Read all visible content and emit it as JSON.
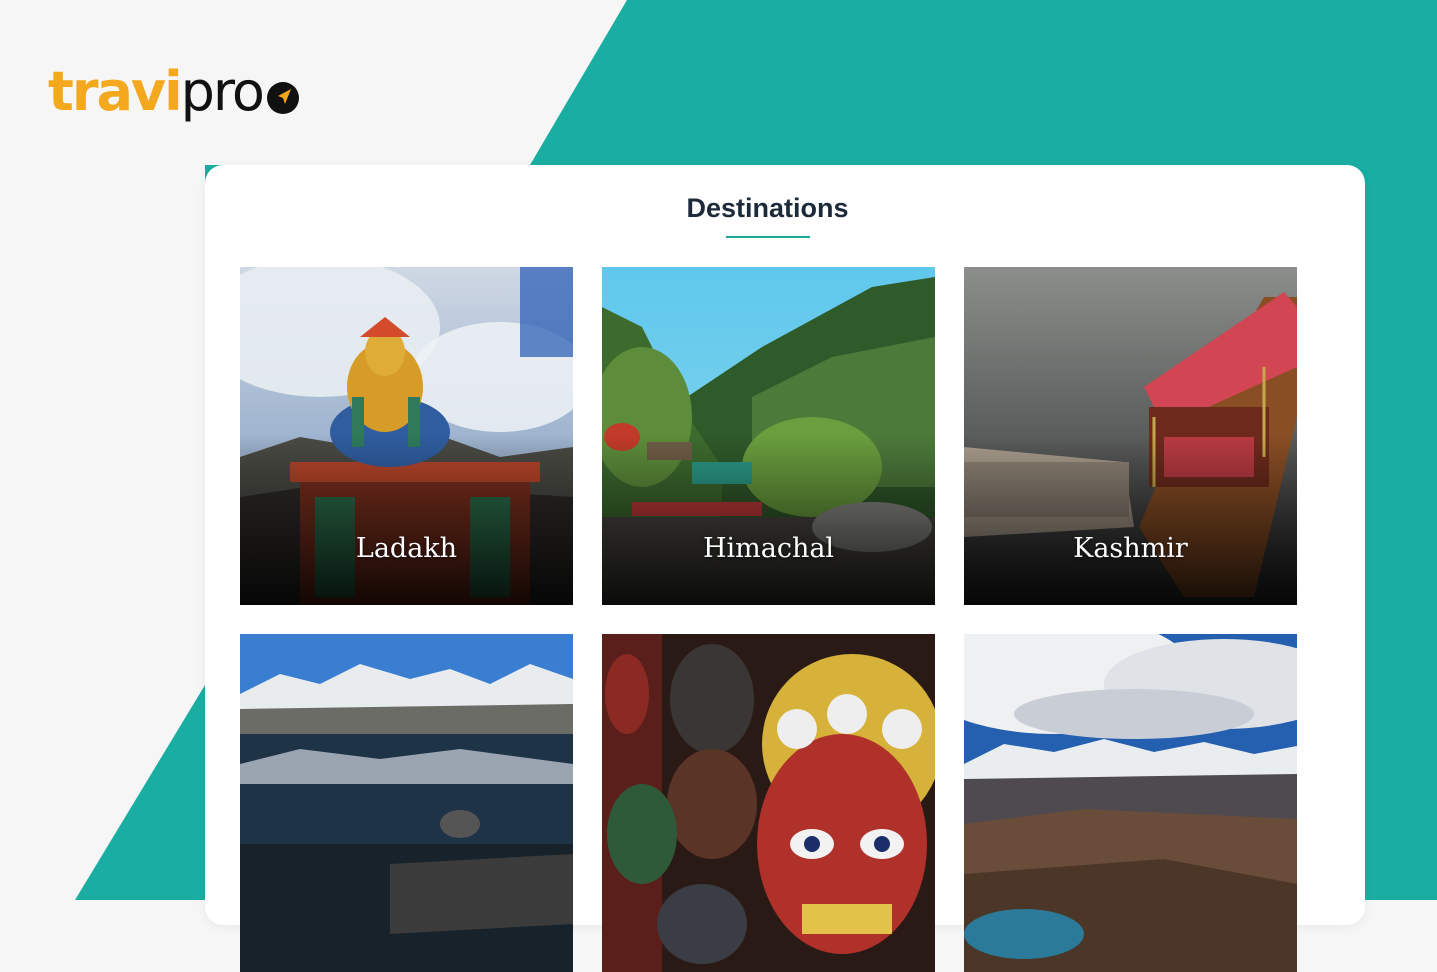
{
  "brand": {
    "name_part1": "travi",
    "name_part2": "pro",
    "accent_color": "#f4a81d",
    "icon": "navigation-arrow-icon"
  },
  "colors": {
    "teal": "#1aaea3",
    "background": "#f6f6f6",
    "underline": "#1aa89a"
  },
  "section": {
    "title": "Destinations"
  },
  "destinations": [
    {
      "label": "Ladakh",
      "image": "buddha-statue-mountains"
    },
    {
      "label": "Himachal",
      "image": "pine-forest-valley"
    },
    {
      "label": "Kashmir",
      "image": "shikara-boat-lake"
    },
    {
      "label": "",
      "image": "mountain-lake-reflection"
    },
    {
      "label": "",
      "image": "colorful-masks"
    },
    {
      "label": "",
      "image": "snow-range-plateau"
    }
  ]
}
